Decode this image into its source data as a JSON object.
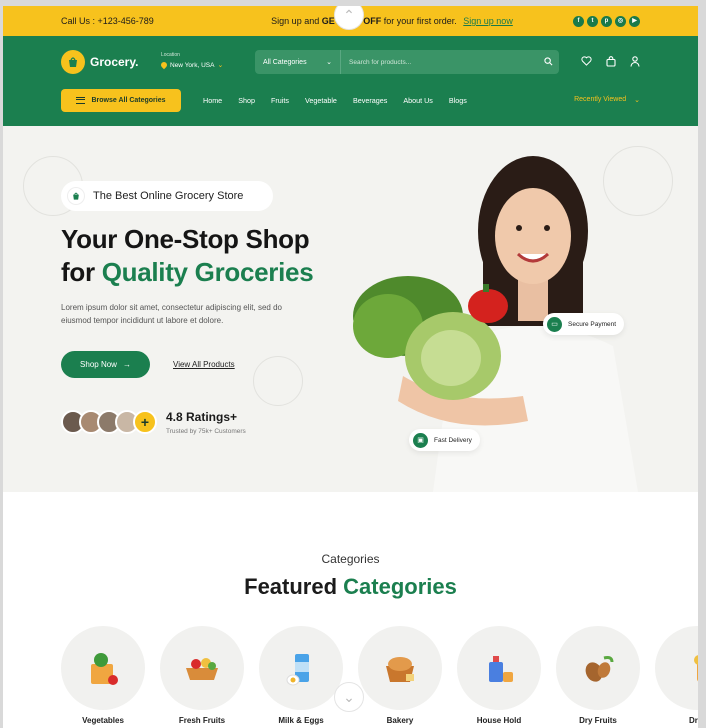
{
  "topbar": {
    "call": "Call Us : +123-456-789",
    "promo_prefix": "Sign up and ",
    "promo_bold": "GET 25% OFF",
    "promo_suffix": " for your first order.",
    "signup_link": "Sign up now",
    "socials": [
      "facebook-icon",
      "twitter-icon",
      "pinterest-icon",
      "instagram-icon",
      "youtube-icon"
    ]
  },
  "header": {
    "logo": "Grocery.",
    "location_label": "Location",
    "location_value": "New York, USA",
    "search_category": "All Categories",
    "search_placeholder": "Search for products...",
    "browse_label": "Browse All Categories",
    "nav": [
      "Home",
      "Shop",
      "Fruits",
      "Vegetable",
      "Beverages",
      "About Us",
      "Blogs"
    ],
    "recently_viewed": "Recently Viewed"
  },
  "hero": {
    "tag": "The Best Online Grocery Store",
    "headline_line1": "Your One-Stop Shop",
    "headline_line2_prefix": "for ",
    "headline_line2_green": "Quality Groceries",
    "lorem": "Lorem ipsum dolor sit amet, consectetur adipiscing elit, sed do eiusmod tempor incididunt ut labore et dolore.",
    "shop_now": "Shop Now",
    "view_all": "View All Products",
    "rating": "4.8 Ratings+",
    "rating_sub": "Trusted by 75k+ Customers",
    "secure_payment": "Secure Payment",
    "fast_delivery": "Fast Delivery"
  },
  "categories": {
    "subtitle": "Categories",
    "title_prefix": "Featured ",
    "title_green": "Categories",
    "items": [
      {
        "label": "Vegetables"
      },
      {
        "label": "Fresh Fruits"
      },
      {
        "label": "Milk & Eggs"
      },
      {
        "label": "Bakery"
      },
      {
        "label": "House Hold"
      },
      {
        "label": "Dry Fruits"
      },
      {
        "label": "Drin"
      }
    ]
  },
  "colors": {
    "brand_green": "#1b7f4f",
    "accent_yellow": "#f7c21d"
  }
}
